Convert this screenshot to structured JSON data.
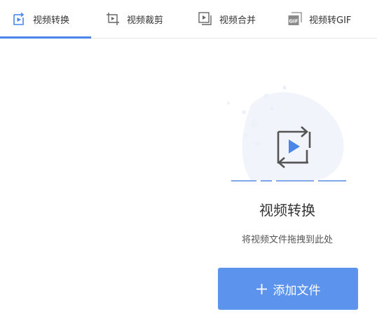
{
  "tabs": [
    {
      "label": "视频转换",
      "icon": "video-convert-icon",
      "active": true
    },
    {
      "label": "视频裁剪",
      "icon": "video-crop-icon",
      "active": false
    },
    {
      "label": "视频合并",
      "icon": "video-merge-icon",
      "active": false
    },
    {
      "label": "视频转GIF",
      "icon": "video-gif-icon",
      "active": false
    }
  ],
  "gif_badge": "GIF",
  "drop_zone": {
    "title": "视频转换",
    "hint": "将视频文件拖拽到此处",
    "add_button_label": "添加文件"
  },
  "colors": {
    "accent": "#4a86e8",
    "button": "#5b93ed",
    "icon_dark": "#555555"
  }
}
